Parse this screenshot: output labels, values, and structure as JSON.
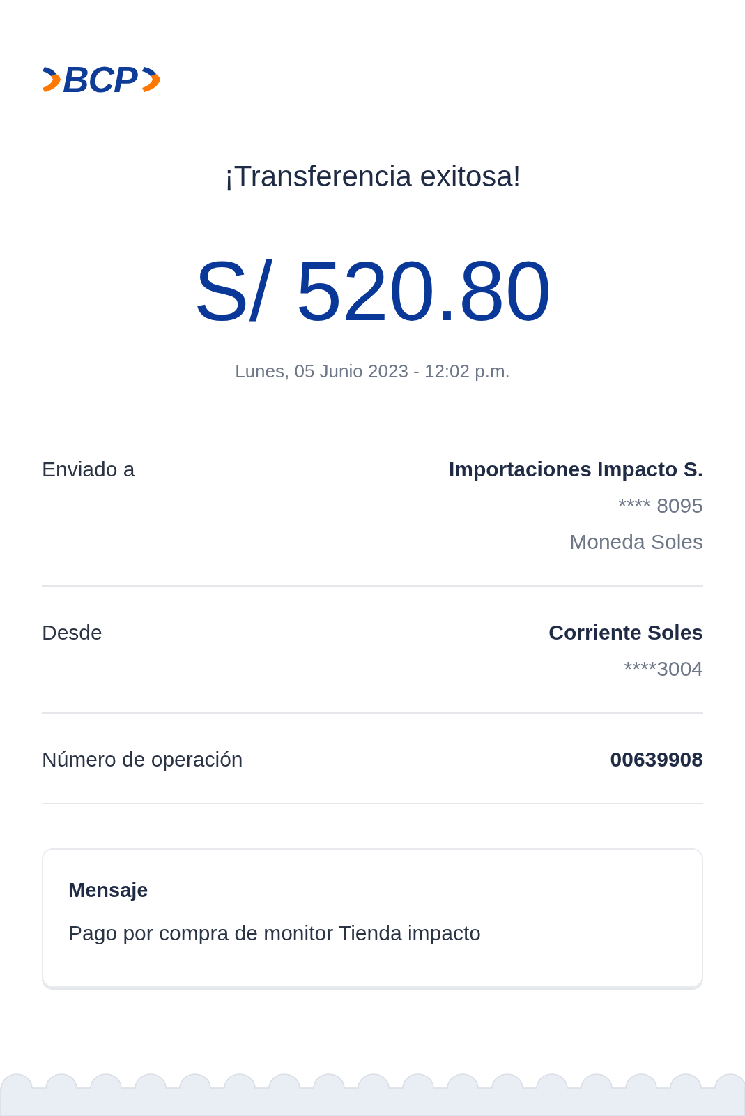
{
  "logo": {
    "text": "BCP"
  },
  "title": "¡Transferencia exitosa!",
  "amount": "S/ 520.80",
  "datetime": "Lunes, 05 Junio 2023 - 12:02 p.m.",
  "details": [
    {
      "label": "Enviado a",
      "lines": [
        {
          "text": "Importaciones Impacto S.",
          "kind": "primary"
        },
        {
          "text": "**** 8095",
          "kind": "secondary"
        },
        {
          "text": "Moneda Soles",
          "kind": "secondary"
        }
      ]
    },
    {
      "label": "Desde",
      "lines": [
        {
          "text": "Corriente Soles",
          "kind": "primary"
        },
        {
          "text": "****3004",
          "kind": "secondary"
        }
      ]
    },
    {
      "label": "Número de operación",
      "lines": [
        {
          "text": "00639908",
          "kind": "primary"
        }
      ]
    }
  ],
  "message": {
    "title": "Mensaje",
    "text": "Pago por compra de monitor Tienda impacto"
  }
}
